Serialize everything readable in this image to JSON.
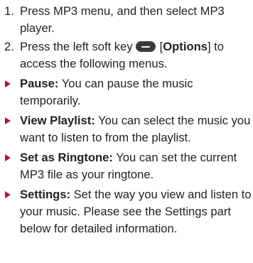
{
  "steps": [
    {
      "number": "1.",
      "text": "Press MP3 menu, and then select MP3 player."
    },
    {
      "number": "2.",
      "before_key": "Press the left soft key",
      "key_icon": "left-soft-key-icon",
      "open_bracket": "[",
      "bold_term": "Options",
      "close_bracket_rest": "] to access the following menus."
    }
  ],
  "bullets": [
    {
      "term": "Pause:",
      "text": " You can pause the music temporarily."
    },
    {
      "term": "View Playlist:",
      "text": " You can select the music you want to listen to from the playlist."
    },
    {
      "term": "Set as Ringtone:",
      "text": " You can set the current MP3 file as your ringtone."
    },
    {
      "term": "Settings:",
      "text": " Set the way you view and listen to your music. Please see the Settings part below for detailed information."
    }
  ],
  "colors": {
    "text": "#231f20",
    "bullet_arrow": "#9e1b32",
    "soft_key": "#3a3a3a"
  }
}
